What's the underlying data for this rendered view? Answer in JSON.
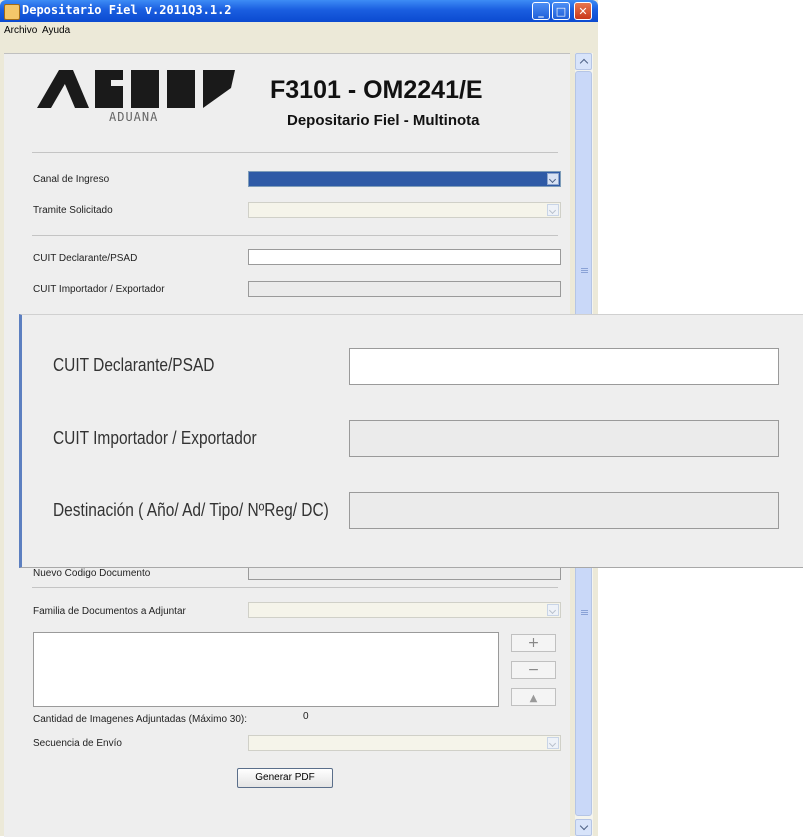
{
  "window": {
    "title": "Depositario Fiel v.2011Q3.1.2",
    "buttons": {
      "minimize": "_",
      "maximize": "□",
      "close": "✕"
    }
  },
  "menu": {
    "archivo": "Archivo",
    "ayuda": "Ayuda"
  },
  "header": {
    "logo_text": "AFIP",
    "logo_sub": "ADUANA",
    "form_code": "F3101 - OM2241/E",
    "form_subtitle": "Depositario Fiel - Multinota"
  },
  "form": {
    "canal_ingreso": {
      "label": "Canal de Ingreso",
      "value": ""
    },
    "tramite_solicitado": {
      "label": "Tramite Solicitado",
      "value": ""
    },
    "cuit_declarante": {
      "label": "CUIT Declarante/PSAD",
      "value": ""
    },
    "cuit_importador": {
      "label": "CUIT Importador / Exportador",
      "value": ""
    },
    "nuevo_codigo": {
      "label": "Nuevo Codigo Documento",
      "value": ""
    },
    "familia_documentos": {
      "label": "Familia de Documentos a Adjuntar",
      "value": ""
    },
    "attach_buttons": {
      "add": "+",
      "remove": "−",
      "scan": "▲"
    },
    "cantidad_imagenes": {
      "label": "Cantidad de Imagenes Adjuntadas (Máximo 30):",
      "value": "0"
    },
    "secuencia_envio": {
      "label": "Secuencia de Envío",
      "value": ""
    },
    "generar_pdf": "Generar PDF"
  },
  "zoom": {
    "cuit_declarante_label": "CUIT Declarante/PSAD",
    "cuit_importador_label": "CUIT Importador / Exportador",
    "destinacion_label": "Destinación ( Año/  Ad/ Tipo/ NºReg/ DC)"
  },
  "colors": {
    "titlebar": "#1a5ee0",
    "accent": "#2e5aa6",
    "window_bg": "#ece9d8",
    "panel_bg": "#eeeeee"
  }
}
